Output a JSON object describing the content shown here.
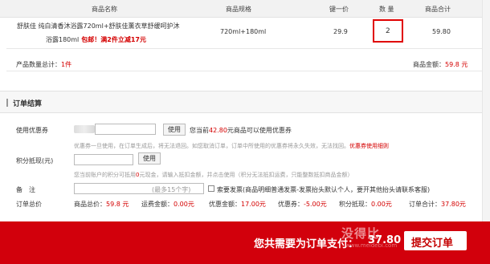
{
  "table_header": {
    "name": "商品名称",
    "spec": "商品规格",
    "price": "键一价",
    "qty": "数 量",
    "subtotal": "商品合计"
  },
  "product": {
    "name_line1": "舒肤佳 纯白清香沐浴露720ml+舒肤佳薰衣草舒缓呵护沐",
    "name_line2": "浴露180ml",
    "promo": "包邮！满2件立减17元",
    "spec": "720ml+180ml",
    "price": "29.9",
    "qty": "2",
    "subtotal": "59.80"
  },
  "summary": {
    "count_label": "产品数量总计：",
    "count_value": "1件",
    "amount_label": "商品金额：",
    "amount_value": "59.8 元"
  },
  "checkout": {
    "title": "订单结算",
    "coupon_label": "使用优惠券",
    "use_btn": "使用",
    "coupon_info_a": "您当前",
    "coupon_info_b": "42.80",
    "coupon_info_c": "元商品可以使用优惠券",
    "coupon_note": "优惠券一旦使用，在订单生成后，将无法退回。如您取消订单，订单中所使用的优惠券将永久失效，无法找回。",
    "coupon_note_link": "优惠券使用细则",
    "points_label": "积分抵现(元)",
    "points_btn": "使用",
    "points_note_a": "您当前账户的积分可抵用",
    "points_note_b": "0",
    "points_note_c": "元现金，请输入抵扣金额，并点击使用（积分无法抵扣运费，只能整数抵扣商品金额）",
    "remark_label": "备　注",
    "remark_placeholder": "(最多15个字)",
    "invoice_label": "索要发票(商品明细普通发票-发票抬头默认个人，要开其他抬头请联系客服)",
    "totals": {
      "order_total_label": "订单总价",
      "goods_label": "商品总价：",
      "goods_value": "59.8 元",
      "freight_label": "运费金额：",
      "freight_value": "0.00元",
      "discount_label": "优惠金额：",
      "discount_value": "17.00元",
      "coupon_label": "优惠券：",
      "coupon_value": "-5.00元",
      "points_label": "积分抵现：",
      "points_value": "0.00元",
      "order_label": "订单合计：",
      "order_value": "37.80元"
    }
  },
  "footer": {
    "pay_label": "您共需要为订单支付：",
    "pay_amount": "37.80",
    "submit": "提交订单",
    "watermark": "没得比",
    "watermark_sub": "www.meidebi.com"
  },
  "colors": {
    "accent_red": "#d2000c",
    "text_red": "#d40000"
  }
}
